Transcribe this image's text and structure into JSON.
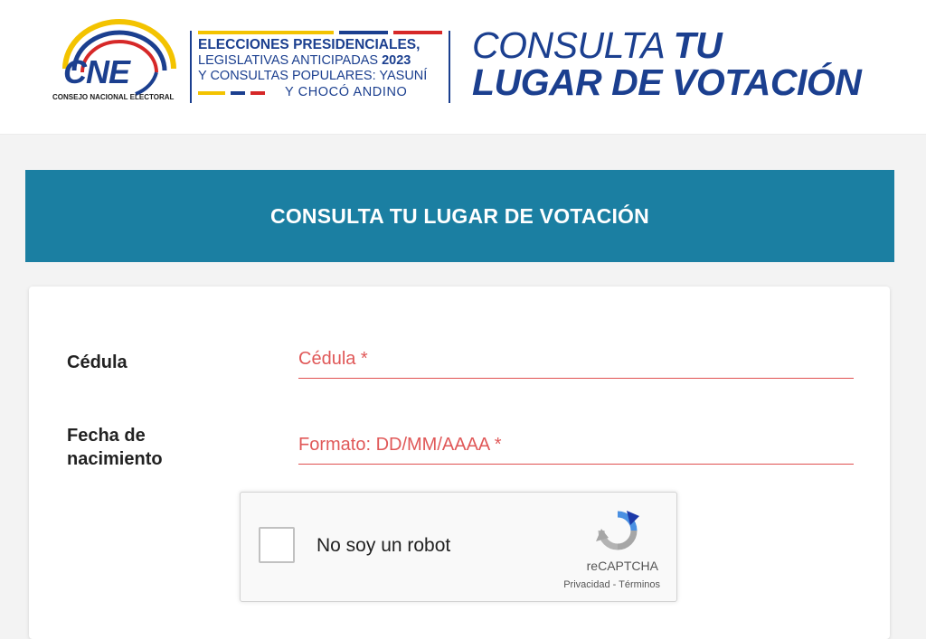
{
  "header": {
    "logo": {
      "letters": "CNE",
      "subtitle": "CONSEJO NACIONAL ELECTORAL",
      "colors": {
        "yellow": "#f3c300",
        "blue": "#1b3f8f",
        "red": "#d62828"
      }
    },
    "election": {
      "line1": "ELECCIONES PRESIDENCIALES,",
      "line2_text": "LEGISLATIVAS ANTICIPADAS",
      "line2_year": "2023",
      "line3": "Y CONSULTAS POPULARES: YASUNÍ",
      "line4": "Y CHOCÓ ANDINO"
    },
    "title": {
      "light": "CONSULTA",
      "bold": "TU",
      "line2": "LUGAR DE VOTACIÓN"
    }
  },
  "banner": {
    "title": "CONSULTA TU LUGAR DE VOTACIÓN",
    "color": "#1b7fa2"
  },
  "form": {
    "cedula": {
      "label": "Cédula",
      "placeholder": "Cédula *",
      "value": ""
    },
    "fecha": {
      "label_line1": "Fecha de",
      "label_line2": "nacimiento",
      "placeholder": "Formato: DD/MM/AAAA *",
      "value": ""
    },
    "accent_color": "#e05050"
  },
  "recaptcha": {
    "checkbox_label": "No soy un robot",
    "brand": "reCAPTCHA",
    "privacy": "Privacidad",
    "separator": " - ",
    "terms": "Términos",
    "icon": "recaptcha-logo-icon"
  }
}
